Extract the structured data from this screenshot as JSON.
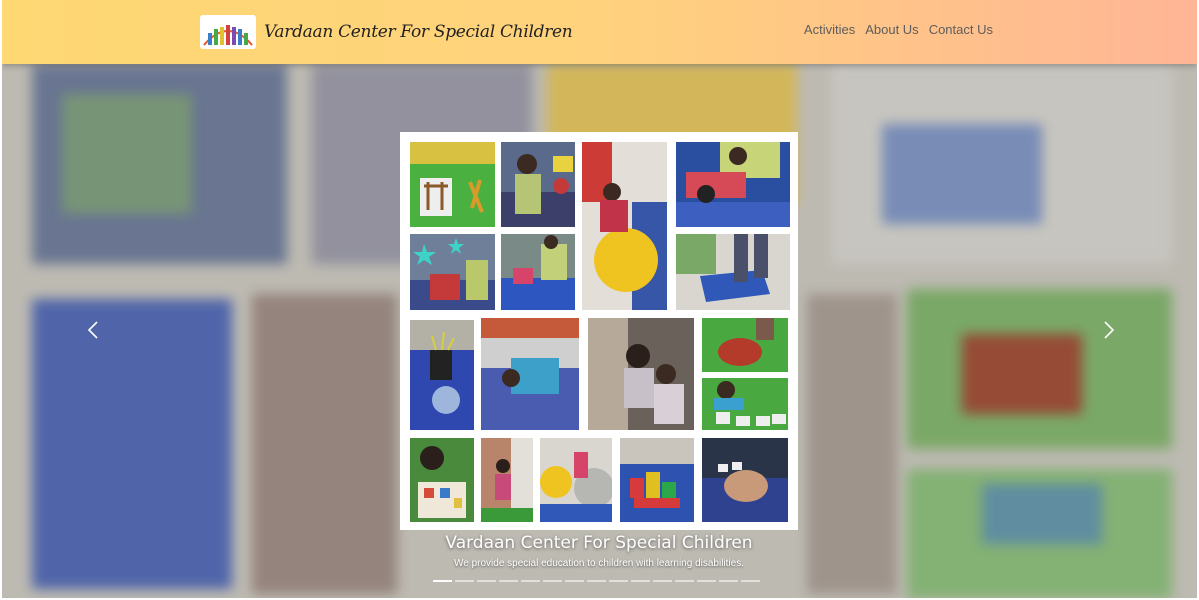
{
  "brand": {
    "name": "Vardaan Center For Special Children",
    "logo_icon": "children-logo-icon"
  },
  "nav": {
    "items": [
      {
        "label": "Activities"
      },
      {
        "label": "About Us"
      },
      {
        "label": "Contact Us"
      }
    ]
  },
  "carousel": {
    "prev_icon": "chevron-left-icon",
    "next_icon": "chevron-right-icon",
    "caption_title": "Vardaan Center For Special Children",
    "caption_text": "We provide special education to children with learning disabilities.",
    "slide_count": 15,
    "active_index": 0
  },
  "colors": {
    "header_left": "#fed873",
    "header_right": "#ffb596",
    "nav_text": "#5d5d5d",
    "caption_text": "#ffffff"
  }
}
